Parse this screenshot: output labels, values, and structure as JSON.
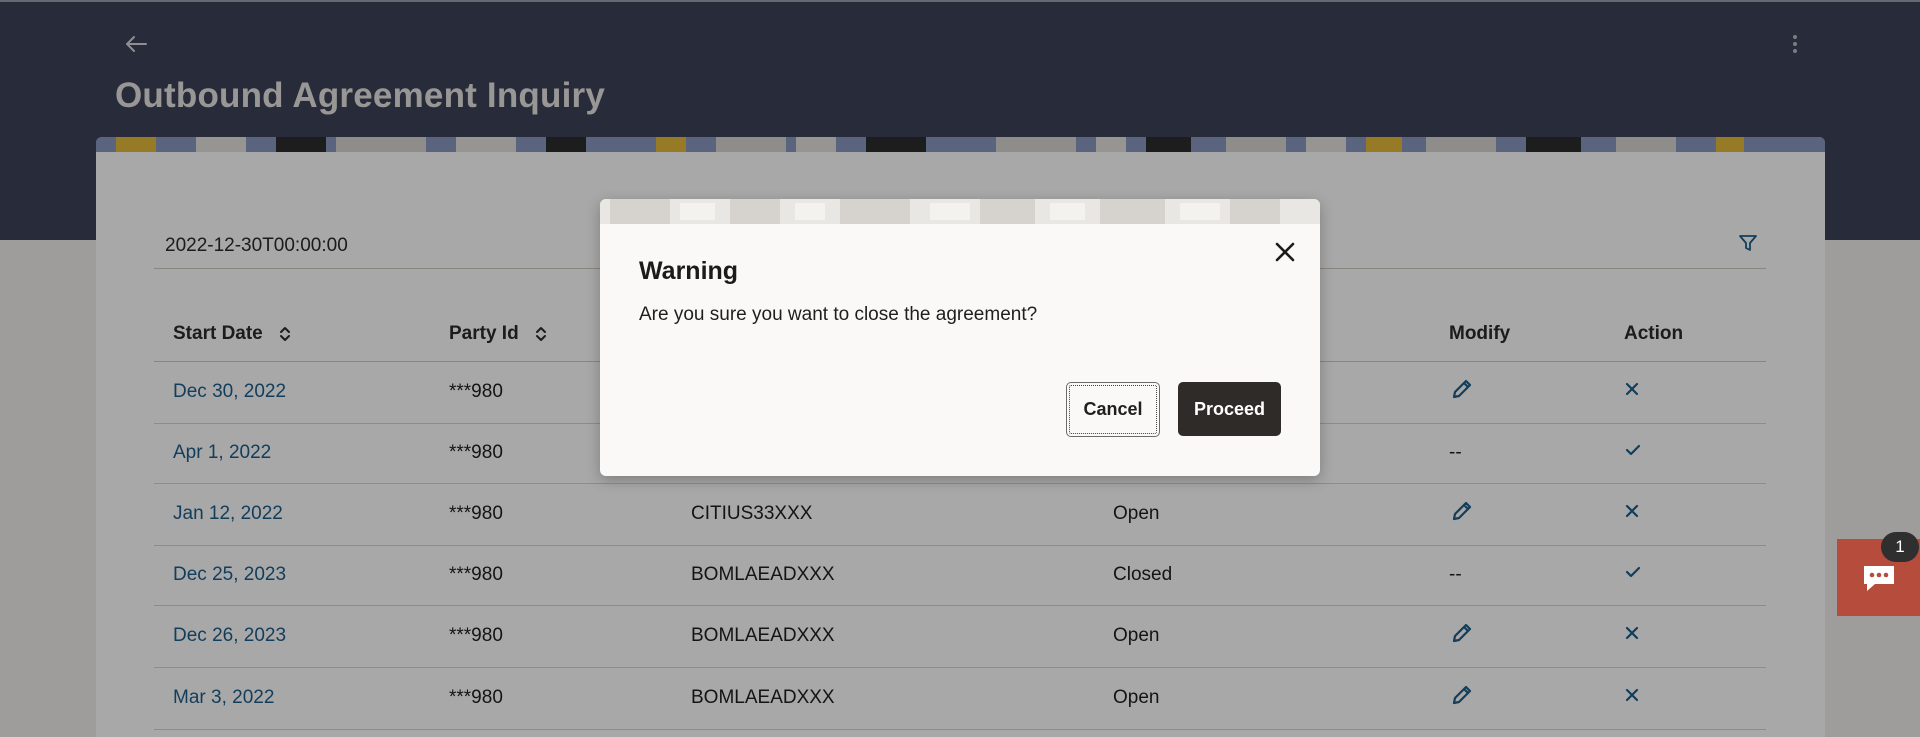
{
  "header": {
    "title": "Outbound Agreement Inquiry",
    "back_icon": "arrow-left-icon",
    "menu_icon": "kebab-vertical-icon"
  },
  "filter": {
    "value": "2022-12-30T00:00:00",
    "icon": "filter-icon"
  },
  "table": {
    "columns": {
      "start_date": "Start Date",
      "party_id": "Party Id",
      "modify": "Modify",
      "action": "Action"
    },
    "rows": [
      {
        "start_date": "Dec 30, 2022",
        "party_id": "***980",
        "bic": "",
        "status": "",
        "modify": "edit",
        "action": "close"
      },
      {
        "start_date": "Apr 1, 2022",
        "party_id": "***980",
        "bic": "",
        "status": "",
        "modify": "--",
        "action": "check"
      },
      {
        "start_date": "Jan 12, 2022",
        "party_id": "***980",
        "bic": "CITIUS33XXX",
        "status": "Open",
        "modify": "edit",
        "action": "close"
      },
      {
        "start_date": "Dec 25, 2023",
        "party_id": "***980",
        "bic": "BOMLAEADXXX",
        "status": "Closed",
        "modify": "--",
        "action": "check"
      },
      {
        "start_date": "Dec 26, 2023",
        "party_id": "***980",
        "bic": "BOMLAEADXXX",
        "status": "Open",
        "modify": "edit",
        "action": "close"
      },
      {
        "start_date": "Mar 3, 2022",
        "party_id": "***980",
        "bic": "BOMLAEADXXX",
        "status": "Open",
        "modify": "edit",
        "action": "close"
      }
    ]
  },
  "dialog": {
    "title": "Warning",
    "message": "Are you sure you want to close the agreement?",
    "cancel_label": "Cancel",
    "proceed_label": "Proceed"
  },
  "chat": {
    "badge": "1",
    "icon": "chat-bubble-icon"
  },
  "colors": {
    "header_bg": "#3d4458",
    "link": "#1d5f8a",
    "proceed_bg": "#2f2b28",
    "chat_bg": "#b64c3b"
  }
}
